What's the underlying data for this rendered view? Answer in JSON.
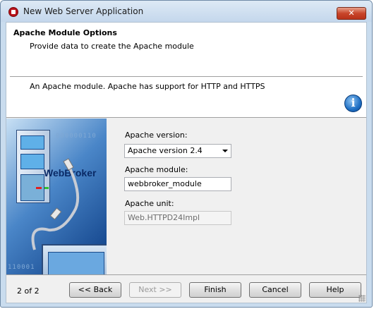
{
  "window": {
    "title": "New Web Server Application",
    "close_label": "✕",
    "app_icon": "delphi-icon"
  },
  "header": {
    "title": "Apache Module Options",
    "subtitle": "Provide data to create the Apache module",
    "description": "An Apache module. Apache has support for HTTP and HTTPS",
    "info_icon": "info-icon",
    "info_glyph": "i"
  },
  "side_image": {
    "brand": "WebBroker",
    "binary_top": "000000110",
    "binary_bottom": "110001"
  },
  "form": {
    "version_label": "Apache version:",
    "version_value": "Apache version 2.4",
    "module_label": "Apache module:",
    "module_value": "webbroker_module",
    "unit_label": "Apache unit:",
    "unit_value": "Web.HTTPD24Impl"
  },
  "footer": {
    "page_indicator": "2 of 2",
    "back_label": "<< Back",
    "next_label": "Next >>",
    "finish_label": "Finish",
    "cancel_label": "Cancel",
    "help_label": "Help"
  }
}
